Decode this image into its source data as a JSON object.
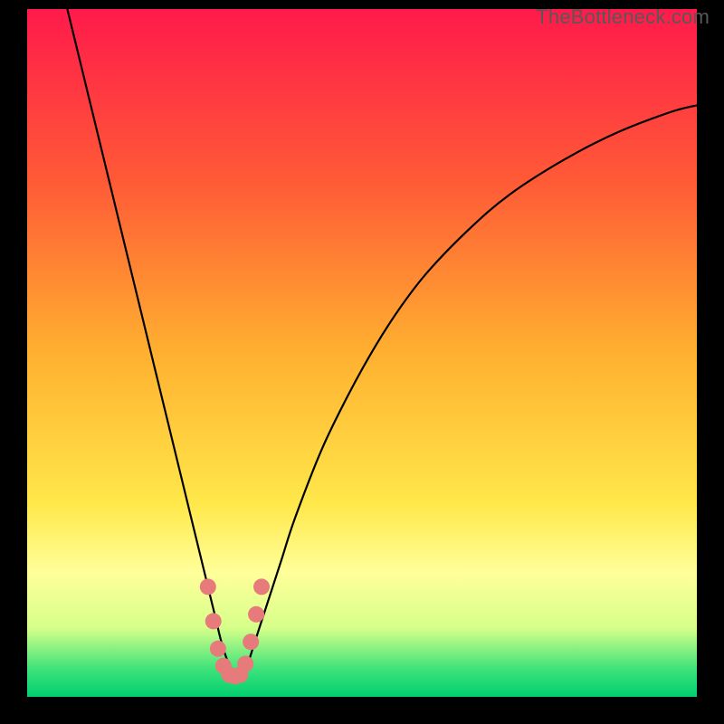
{
  "watermark": "TheBottleneck.com",
  "chart_data": {
    "type": "line",
    "title": "",
    "xlabel": "",
    "ylabel": "",
    "xlim": [
      0,
      100
    ],
    "ylim": [
      0,
      100
    ],
    "grid": false,
    "legend": false,
    "gradient_stops": [
      {
        "offset": 0,
        "color": "#ff1a4b"
      },
      {
        "offset": 25,
        "color": "#ff5a36"
      },
      {
        "offset": 50,
        "color": "#ffb030"
      },
      {
        "offset": 72,
        "color": "#ffe84a"
      },
      {
        "offset": 82,
        "color": "#ffff9a"
      },
      {
        "offset": 90,
        "color": "#d6ff8a"
      },
      {
        "offset": 96,
        "color": "#3de27a"
      },
      {
        "offset": 100,
        "color": "#00d070"
      }
    ],
    "series": [
      {
        "name": "bottleneck-curve",
        "x": [
          6,
          8,
          10,
          12,
          14,
          16,
          18,
          20,
          22,
          24,
          26,
          27,
          28,
          29,
          30,
          31,
          32,
          33,
          34,
          36,
          38,
          40,
          44,
          48,
          52,
          56,
          60,
          66,
          72,
          80,
          88,
          96,
          100
        ],
        "y": [
          100,
          92,
          84,
          76,
          68,
          60,
          52,
          44,
          36,
          28,
          20,
          16,
          12,
          8,
          5,
          3,
          3,
          5,
          8,
          14,
          20,
          26,
          36,
          44,
          51,
          57,
          62,
          68,
          73,
          78,
          82,
          85,
          86
        ]
      }
    ],
    "markers": {
      "name": "highlight-dots",
      "color": "#e77a7a",
      "points": [
        {
          "x": 27.0,
          "y": 16
        },
        {
          "x": 27.8,
          "y": 11
        },
        {
          "x": 28.5,
          "y": 7
        },
        {
          "x": 29.3,
          "y": 4.5
        },
        {
          "x": 30.2,
          "y": 3.2
        },
        {
          "x": 31.0,
          "y": 3.0
        },
        {
          "x": 31.8,
          "y": 3.2
        },
        {
          "x": 32.6,
          "y": 4.8
        },
        {
          "x": 33.4,
          "y": 8
        },
        {
          "x": 34.2,
          "y": 12
        },
        {
          "x": 35.0,
          "y": 16
        }
      ]
    }
  }
}
